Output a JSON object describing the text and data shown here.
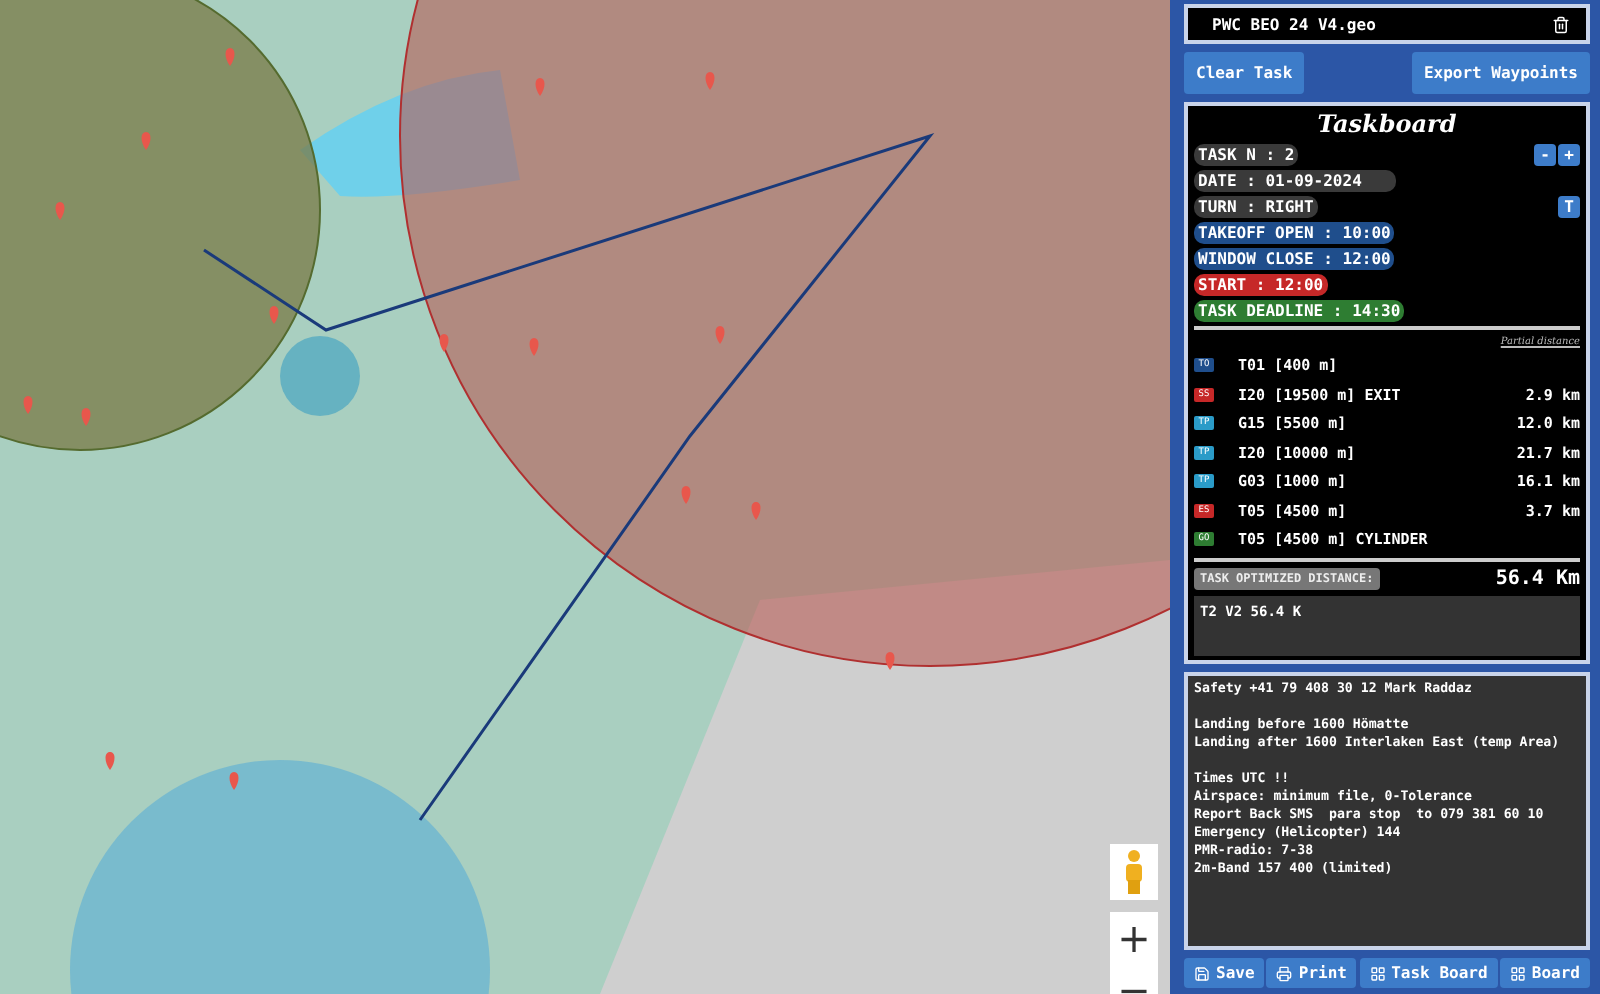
{
  "map": {
    "zoom_in": "+",
    "zoom_out": "−"
  },
  "file": {
    "name": "PWC BEO 24 V4.geo"
  },
  "actions": [
    "Clear Task",
    "Export Waypoints"
  ],
  "taskboard": {
    "title": "Taskboard",
    "fields": [
      {
        "text": "TASK N : 2",
        "color": "#3a3a3a",
        "wide": false
      },
      {
        "text": "DATE : 01-09-2024",
        "color": "#3a3a3a",
        "wide": true
      },
      {
        "text": "TURN : RIGHT",
        "color": "#3a3a3a",
        "wide": false
      },
      {
        "text": "TAKEOFF OPEN : 10:00",
        "color": "#1f4e8c",
        "wide": false
      },
      {
        "text": "WINDOW CLOSE : 12:00",
        "color": "#1f4e8c",
        "wide": false
      },
      {
        "text": "START : 12:00",
        "color": "#c62828",
        "wide": false
      },
      {
        "text": "TASK DEADLINE : 14:30",
        "color": "#2e7d32",
        "wide": false
      }
    ],
    "stepper": [
      "-",
      "+"
    ],
    "turn_button": "T",
    "partial_header": "Partial distance",
    "turnpoints": [
      {
        "type": "TO",
        "color": "#1f4e8c",
        "name": "T01 [400 m]"
      },
      {
        "type": "SS",
        "color": "#c62828",
        "name": "I20 [19500 m] EXIT",
        "distance": "2.9 km"
      },
      {
        "type": "TP",
        "color": "#2a9bc8",
        "name": "G15 [5500 m]",
        "distance": "12.0 km"
      },
      {
        "type": "TP",
        "color": "#2a9bc8",
        "name": "I20 [10000 m]",
        "distance": "21.7 km"
      },
      {
        "type": "TP",
        "color": "#2a9bc8",
        "name": "G03 [1000 m]",
        "distance": "16.1 km"
      },
      {
        "type": "ES",
        "color": "#c62828",
        "name": "T05 [4500 m]",
        "distance": "3.7 km"
      },
      {
        "type": "GO",
        "color": "#2e7d32",
        "name": "T05 [4500 m] CYLINDER"
      }
    ],
    "optimized": {
      "label": "TASK OPTIMIZED DISTANCE:",
      "value": "56.4 Km"
    },
    "summary": "T2 V2 56.4 K"
  },
  "notes": [
    [
      "Safety +41 79 408 30 12 Mark Raddaz"
    ],
    [
      "Landing before 1600 Hömatte",
      "Landing after 1600 Interlaken East (temp Area)"
    ],
    [
      "Times UTC !!",
      "Airspace: minimum file, 0-Tolerance",
      "Report Back SMS  para stop  to 079 381 60 10",
      "Emergency (Helicopter) 144",
      "PMR-radio: 7-38",
      "2m-Band 157 400 (limited)"
    ]
  ],
  "bottom_buttons": [
    "Save",
    "Print",
    "Task Board",
    "Board"
  ]
}
